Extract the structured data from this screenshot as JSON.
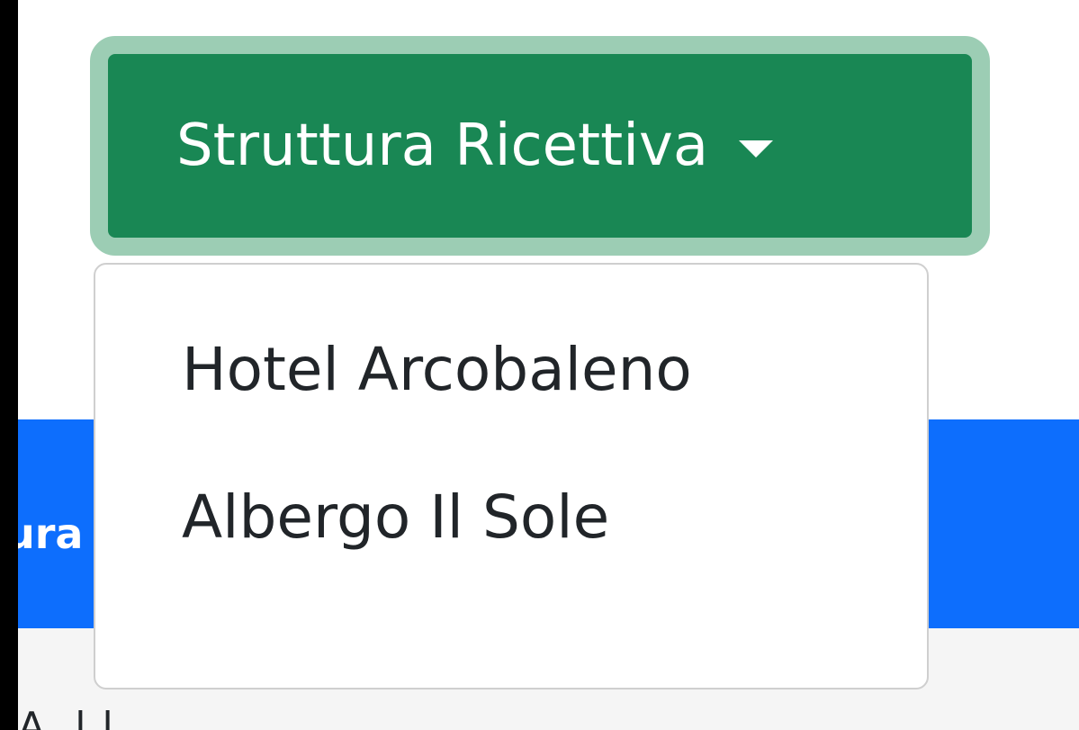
{
  "header": {
    "title_fragment": "ura"
  },
  "table": {
    "head_fragment": "A.  l  l"
  },
  "dropdown": {
    "label": "Struttura Ricettiva",
    "caret_icon": "caret-down-icon",
    "options": [
      "Hotel Arcobaleno",
      "Albergo Il Sole"
    ]
  },
  "colors": {
    "button": "#198754",
    "button_focus_ring": "#9ccdb4",
    "header": "#0d6efd"
  }
}
